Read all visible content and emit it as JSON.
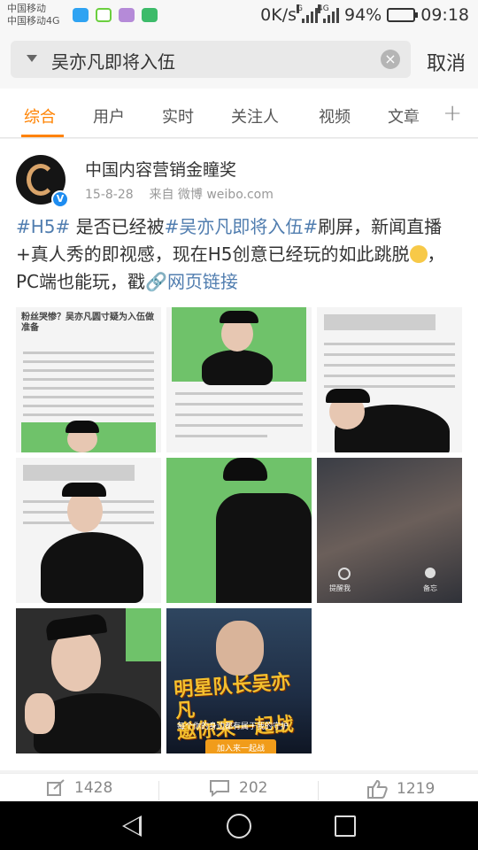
{
  "status_bar": {
    "carrier_1": "中国移动",
    "carrier_2": "中国移动4G",
    "net_speed": "0K/s",
    "signal_1_tag": "G",
    "signal_2_tag": "4G",
    "battery": "94%",
    "battery_level": 0.94,
    "time": "09:18"
  },
  "search": {
    "query": "吴亦凡即将入伍",
    "clear_icon": "clear-icon",
    "cancel_label": "取消"
  },
  "tabs": [
    {
      "label": "综合",
      "active": true
    },
    {
      "label": "用户"
    },
    {
      "label": "实时"
    },
    {
      "label": "关注人"
    },
    {
      "label": "视频"
    },
    {
      "label": "文章"
    }
  ],
  "tabs_more": "+",
  "post": {
    "author": "中国内容营销金瞳奖",
    "date": "15-8-28",
    "source": "来自 微博 weibo.com",
    "hashtag_1": "#H5#",
    "text_1": " 是否已经被",
    "hashtag_2": "#吴亦凡即将入伍#",
    "text_2": "刷屏，新闻直播+真人秀的即视感，现在H5创意已经玩的如此跳脱",
    "text_3": "，PC端也能玩，戳",
    "link_icon": "🔗",
    "link": "网页链接",
    "image_texts": {
      "img1_title": "粉丝哭惨？吴亦凡圆寸疑为入伍做准备",
      "img7_title": "明星队长吴亦凡",
      "img7_title_2": "邀你来一起战",
      "img7_sub": "每个你的身边都有属于我的守护",
      "img7_btn": "加入来一起战",
      "img5_label_1": "提醒我",
      "img5_label_2": "备忘"
    }
  },
  "actions": {
    "repost_count": "1428",
    "comment_count": "202",
    "like_count": "1219"
  },
  "colors": {
    "accent": "#ff8200",
    "link": "#507daf",
    "verified": "#1e8cf0"
  }
}
